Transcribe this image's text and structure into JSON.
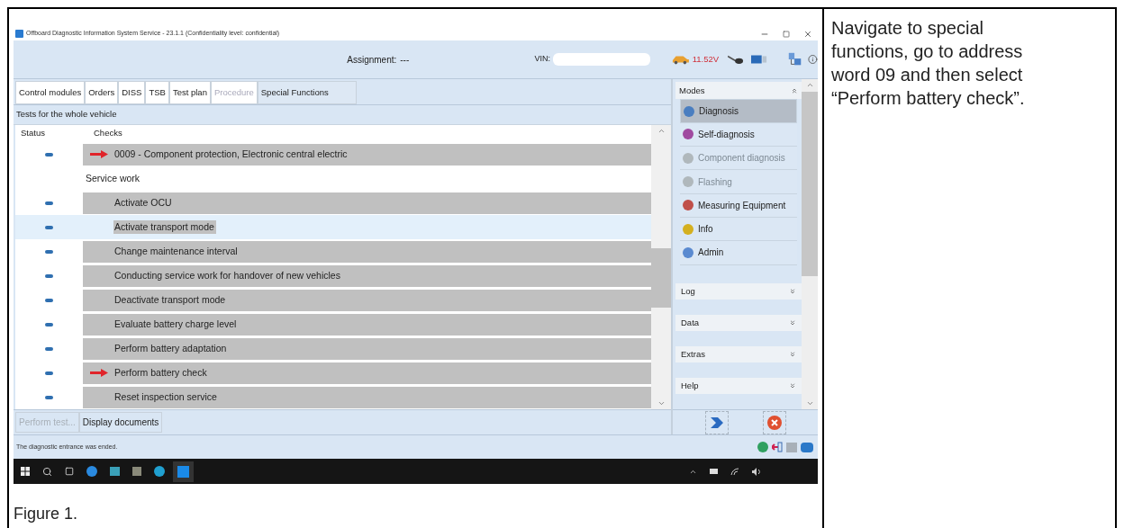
{
  "document": {
    "instruction": "Navigate to special functions, go to address word 09 and then select “Perform battery check”.",
    "caption": "Figure 1."
  },
  "window": {
    "title": "Offboard Diagnostic Information System Service - 23.1.1 (Confidentiality level: confidential)",
    "assignment_label": "Assignment:",
    "assignment_value": "---",
    "vin_label": "VIN:",
    "voltage": "11.52V"
  },
  "tabs": [
    {
      "label": "Control modules",
      "selected": false,
      "disabled": false
    },
    {
      "label": "Orders",
      "selected": false,
      "disabled": false
    },
    {
      "label": "DISS",
      "selected": false,
      "disabled": false
    },
    {
      "label": "TSB",
      "selected": false,
      "disabled": false
    },
    {
      "label": "Test plan",
      "selected": false,
      "disabled": false
    },
    {
      "label": "Procedure",
      "selected": false,
      "disabled": true
    },
    {
      "label": "Special Functions",
      "selected": true,
      "disabled": false
    }
  ],
  "section_title": "Tests for the whole vehicle",
  "table": {
    "columns": [
      "Status",
      "Checks"
    ],
    "rows": [
      {
        "kind": "check",
        "label": "0009 - Component protection, Electronic central electric",
        "marked": true,
        "selected": false
      },
      {
        "kind": "group",
        "label": "Service work",
        "children": [
          {
            "kind": "check",
            "label": "Activate OCU",
            "marked": false,
            "selected": false
          },
          {
            "kind": "check",
            "label": "Activate transport mode",
            "marked": false,
            "selected": true
          },
          {
            "kind": "check",
            "label": "Change maintenance interval",
            "marked": false,
            "selected": false
          },
          {
            "kind": "check",
            "label": "Conducting service work for handover of new vehicles",
            "marked": false,
            "selected": false
          },
          {
            "kind": "check",
            "label": "Deactivate transport mode",
            "marked": false,
            "selected": false
          },
          {
            "kind": "check",
            "label": "Evaluate battery charge level",
            "marked": false,
            "selected": false
          },
          {
            "kind": "check",
            "label": "Perform battery adaptation",
            "marked": false,
            "selected": false
          },
          {
            "kind": "check",
            "label": "Perform battery check",
            "marked": true,
            "selected": false
          },
          {
            "kind": "check",
            "label": "Reset inspection service",
            "marked": false,
            "selected": false
          }
        ]
      }
    ]
  },
  "footer_buttons": [
    {
      "label": "Perform test...",
      "disabled": true
    },
    {
      "label": "Display documents",
      "disabled": false
    }
  ],
  "modes": {
    "title": "Modes",
    "expanded": true,
    "items": [
      {
        "label": "Diagnosis",
        "selected": true,
        "disabled": false
      },
      {
        "label": "Self-diagnosis",
        "selected": false,
        "disabled": false
      },
      {
        "label": "Component diagnosis",
        "selected": false,
        "disabled": true
      },
      {
        "label": "Flashing",
        "selected": false,
        "disabled": true
      },
      {
        "label": "Measuring Equipment",
        "selected": false,
        "disabled": false
      },
      {
        "label": "Info",
        "selected": false,
        "disabled": false
      },
      {
        "label": "Admin",
        "selected": false,
        "disabled": false
      }
    ]
  },
  "panels": [
    {
      "label": "Log",
      "expanded": false
    },
    {
      "label": "Data",
      "expanded": false
    },
    {
      "label": "Extras",
      "expanded": false
    },
    {
      "label": "Help",
      "expanded": false
    }
  ],
  "status_bar": "The diagnostic entrance was ended."
}
